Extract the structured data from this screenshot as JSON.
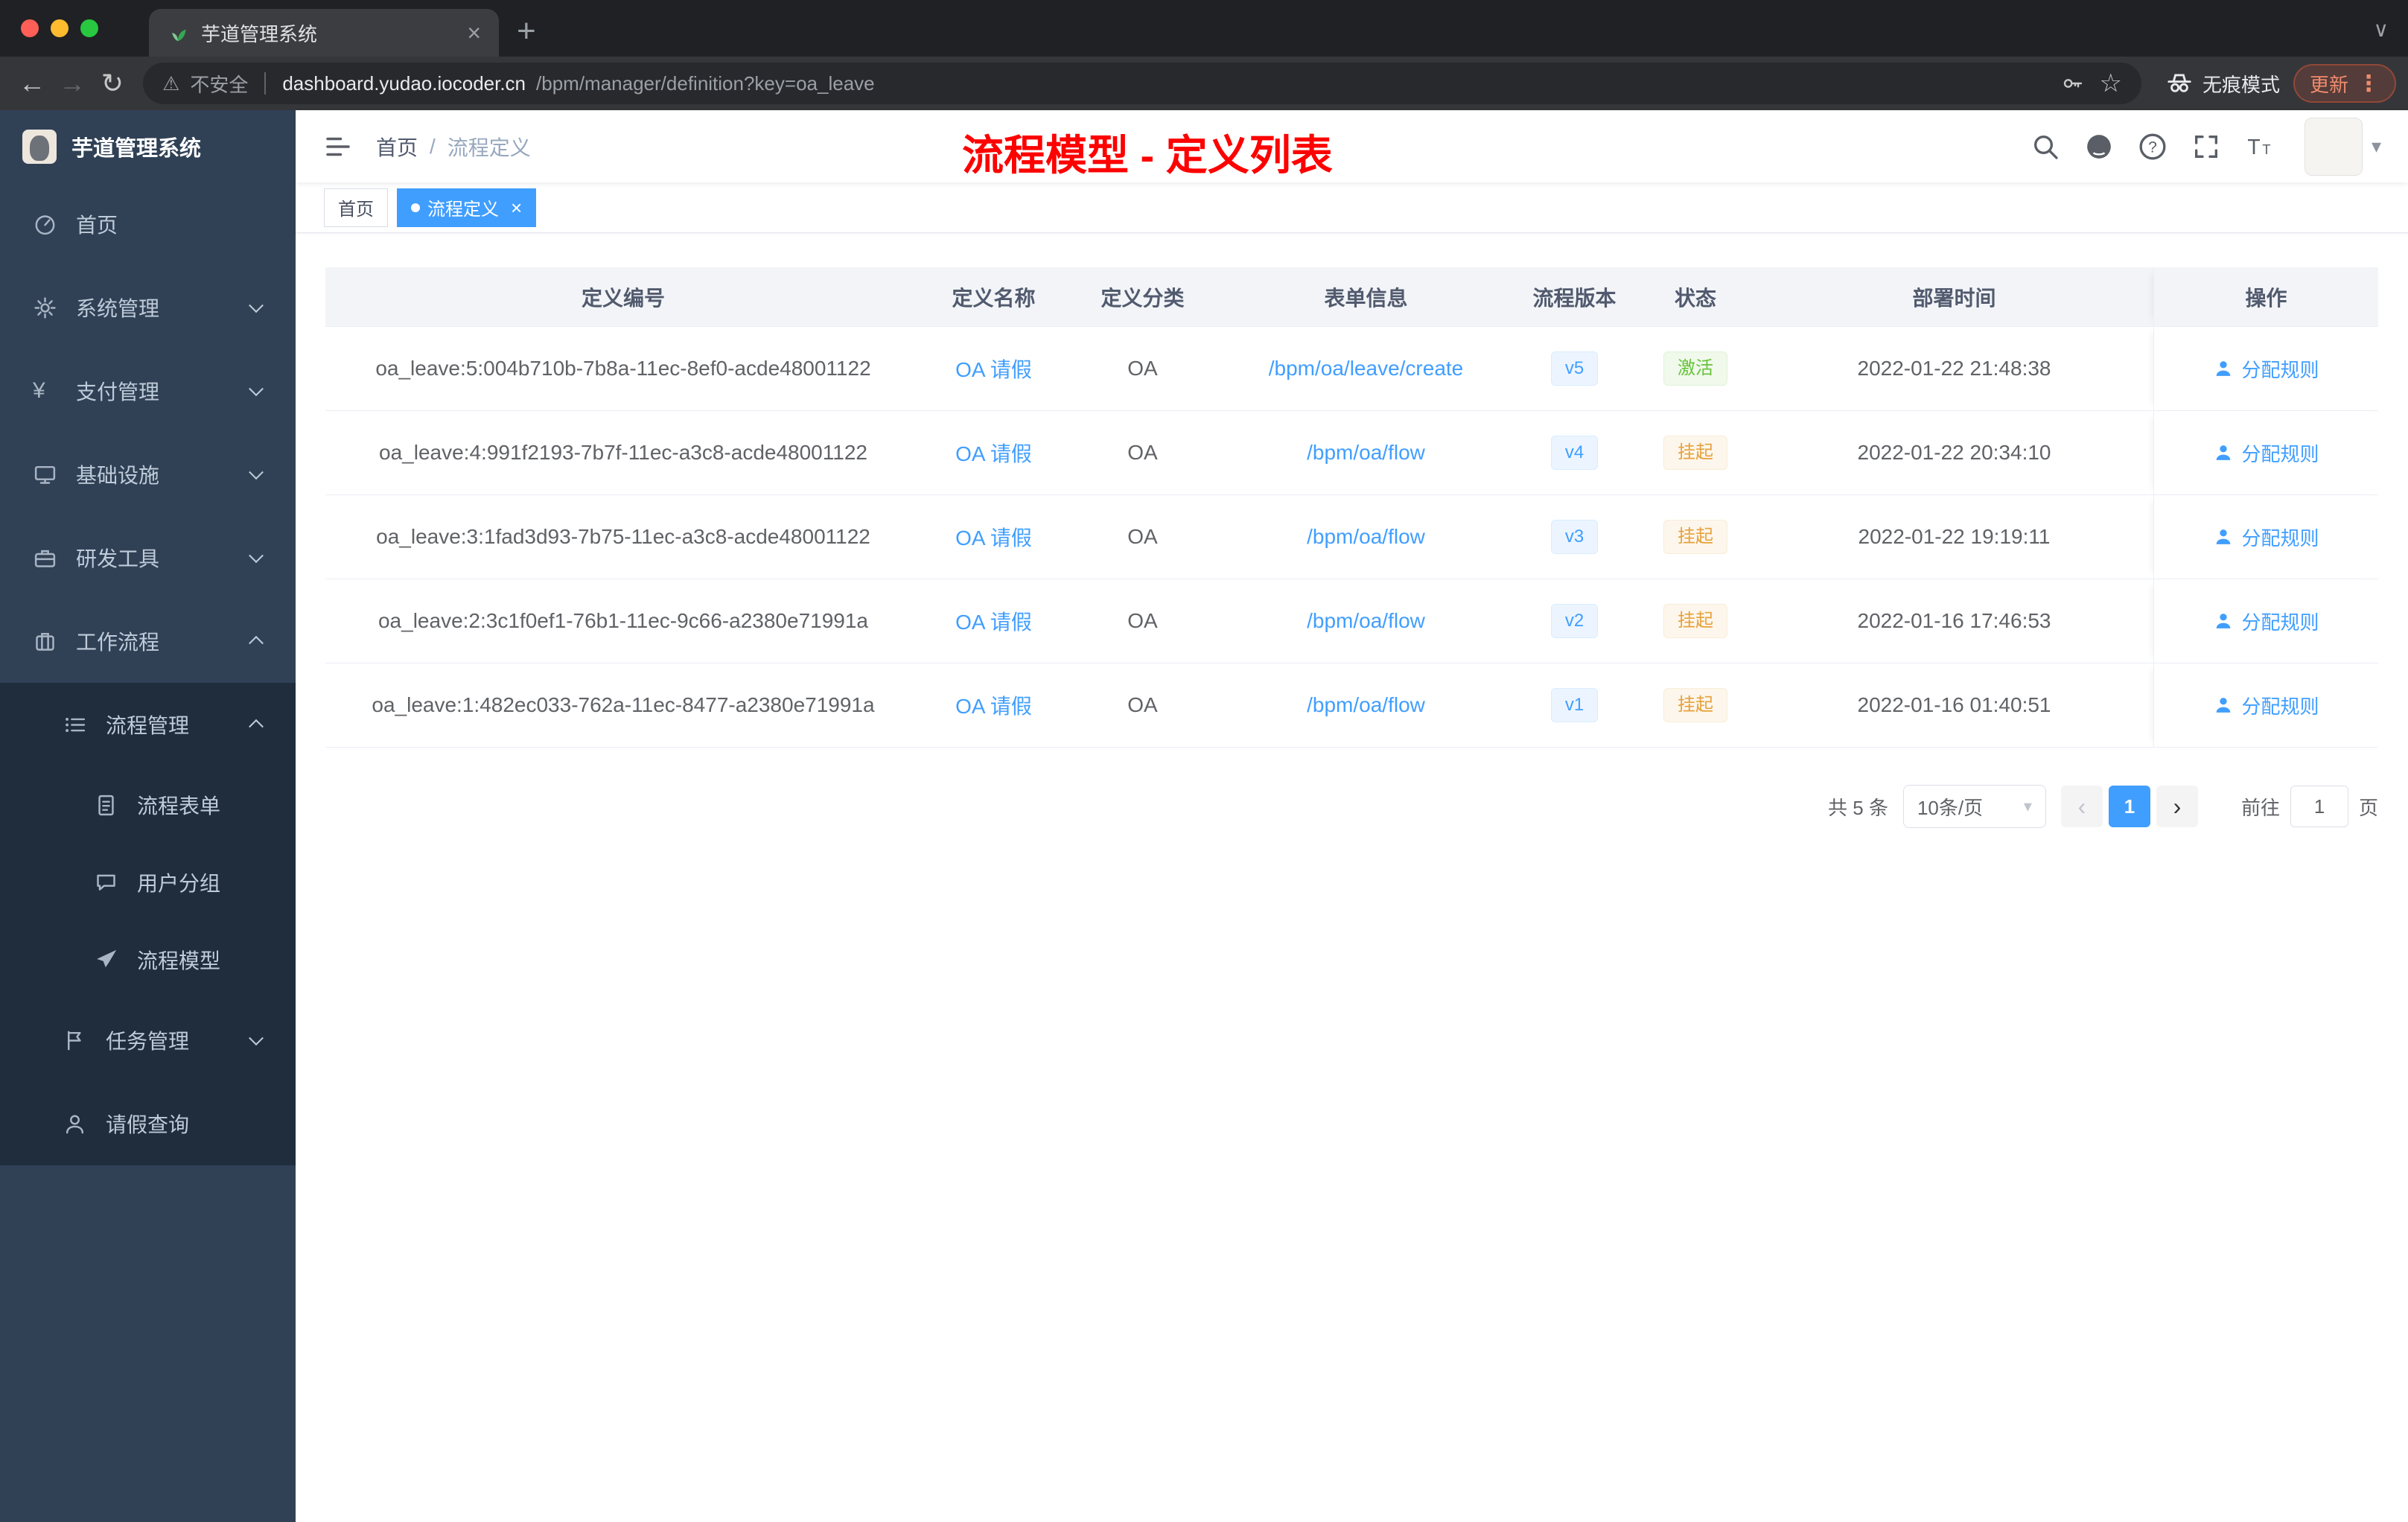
{
  "colors": {
    "accent": "#409eff",
    "annotation_red": "#fd0000",
    "status_success": "#67c23a",
    "status_warning": "#e6a23c",
    "sidebar_bg": "#304156",
    "submenu_bg": "#1f2d3d"
  },
  "browser": {
    "tab_title": "芋道管理系统",
    "security_label": "不安全",
    "url_host": "dashboard.yudao.iocoder.cn",
    "url_path": "/bpm/manager/definition?key=oa_leave",
    "incognito_label": "无痕模式",
    "update_label": "更新"
  },
  "icons": {
    "back": "←",
    "forward": "→",
    "reload": "↻",
    "warning": "⚠",
    "star": "☆",
    "close": "×",
    "new_tab": "+",
    "more": "⋮",
    "tab_chevron": "∨",
    "caret": "▾",
    "prev": "‹",
    "next": "›",
    "yen": "¥"
  },
  "sidebar": {
    "app_title": "芋道管理系统",
    "items": [
      {
        "label": "首页"
      },
      {
        "label": "系统管理"
      },
      {
        "label": "支付管理"
      },
      {
        "label": "基础设施"
      },
      {
        "label": "研发工具"
      },
      {
        "label": "工作流程"
      },
      {
        "label": "流程管理"
      },
      {
        "label": "流程表单"
      },
      {
        "label": "用户分组"
      },
      {
        "label": "流程模型"
      },
      {
        "label": "任务管理"
      },
      {
        "label": "请假查询"
      }
    ]
  },
  "header": {
    "breadcrumb_home": "首页",
    "breadcrumb_separator": "/",
    "breadcrumb_current": "流程定义",
    "annotation": "流程模型 - 定义列表"
  },
  "tags_view": {
    "home": "首页",
    "active": "流程定义"
  },
  "table": {
    "columns": {
      "id": "定义编号",
      "name": "定义名称",
      "category": "定义分类",
      "form": "表单信息",
      "version": "流程版本",
      "status": "状态",
      "deploy_time": "部署时间",
      "actions": "操作"
    },
    "rows": [
      {
        "id": "oa_leave:5:004b710b-7b8a-11ec-8ef0-acde48001122",
        "name": "OA 请假",
        "category": "OA",
        "form": "/bpm/oa/leave/create",
        "version": "v5",
        "status": "激活",
        "status_type": "success",
        "deploy_time": "2022-01-22 21:48:38",
        "action": "分配规则"
      },
      {
        "id": "oa_leave:4:991f2193-7b7f-11ec-a3c8-acde48001122",
        "name": "OA 请假",
        "category": "OA",
        "form": "/bpm/oa/flow",
        "version": "v4",
        "status": "挂起",
        "status_type": "warning",
        "deploy_time": "2022-01-22 20:34:10",
        "action": "分配规则"
      },
      {
        "id": "oa_leave:3:1fad3d93-7b75-11ec-a3c8-acde48001122",
        "name": "OA 请假",
        "category": "OA",
        "form": "/bpm/oa/flow",
        "version": "v3",
        "status": "挂起",
        "status_type": "warning",
        "deploy_time": "2022-01-22 19:19:11",
        "action": "分配规则"
      },
      {
        "id": "oa_leave:2:3c1f0ef1-76b1-11ec-9c66-a2380e71991a",
        "name": "OA 请假",
        "category": "OA",
        "form": "/bpm/oa/flow",
        "version": "v2",
        "status": "挂起",
        "status_type": "warning",
        "deploy_time": "2022-01-16 17:46:53",
        "action": "分配规则"
      },
      {
        "id": "oa_leave:1:482ec033-762a-11ec-8477-a2380e71991a",
        "name": "OA 请假",
        "category": "OA",
        "form": "/bpm/oa/flow",
        "version": "v1",
        "status": "挂起",
        "status_type": "warning",
        "deploy_time": "2022-01-16 01:40:51",
        "action": "分配规则"
      }
    ]
  },
  "pagination": {
    "total": "共 5 条",
    "page_size": "10条/页",
    "current_page": "1",
    "goto_label": "前往",
    "goto_value": "1",
    "page_unit": "页"
  }
}
